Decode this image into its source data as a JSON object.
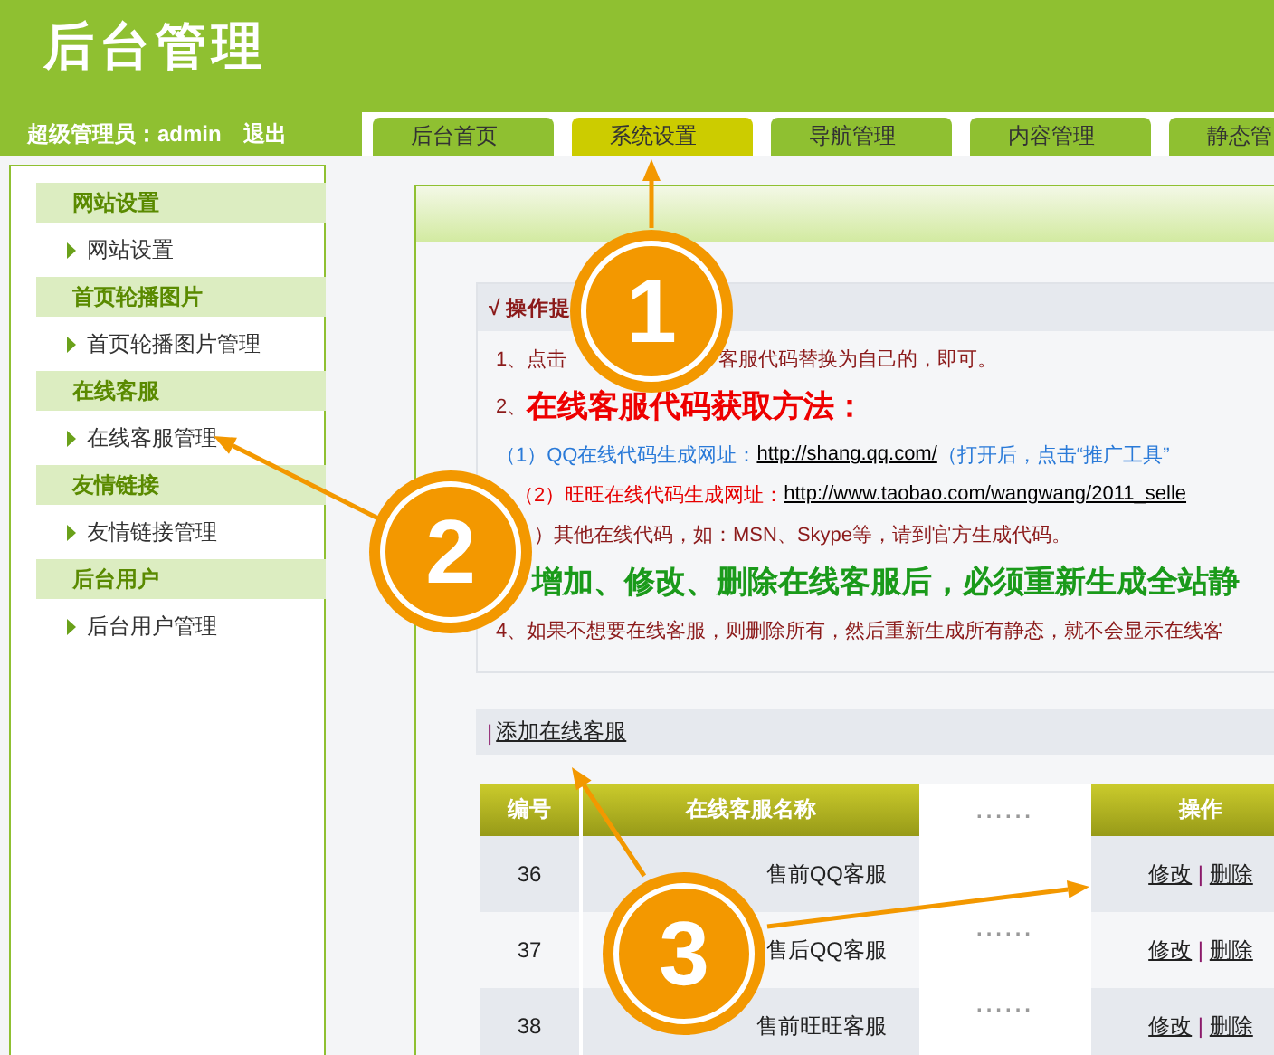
{
  "header": {
    "title": "后台管理",
    "user_label": "超级管理员：admin",
    "logout": "退出"
  },
  "tabs": [
    {
      "label": "后台首页",
      "selected": false
    },
    {
      "label": "系统设置",
      "selected": true
    },
    {
      "label": "导航管理",
      "selected": false
    },
    {
      "label": "内容管理",
      "selected": false
    },
    {
      "label": "静态管",
      "selected": false
    }
  ],
  "sidebar": {
    "sections": [
      {
        "title": "网站设置",
        "items": [
          "网站设置"
        ]
      },
      {
        "title": "首页轮播图片",
        "items": [
          "首页轮播图片管理"
        ]
      },
      {
        "title": "在线客服",
        "items": [
          "在线客服管理"
        ]
      },
      {
        "title": "友情链接",
        "items": [
          "友情链接管理"
        ]
      },
      {
        "title": "后台用户",
        "items": [
          "后台用户管理"
        ]
      }
    ]
  },
  "notice": {
    "title": "√ 操作提",
    "lines": [
      {
        "kind": "gap",
        "before": "1、点击",
        "after": "客服代码替换为自己的，即可。"
      },
      {
        "kind": "heading",
        "number": "2、",
        "text": "在线客服代码获取方法："
      },
      {
        "kind": "link",
        "color": "#2a7ad8",
        "text": "（1）QQ在线代码生成网址：",
        "link": "http://shang.qq.com/",
        "after": "（打开后，点击“推广工具”"
      },
      {
        "kind": "link",
        "color": "#e60000",
        "text": "（2）旺旺在线代码生成网址：",
        "link": "http://www.taobao.com/wangwang/2011_selle"
      },
      {
        "kind": "indent",
        "text": "）其他在线代码，如：MSN、Skype等，请到官方生成代码。"
      },
      {
        "kind": "warning",
        "text": "增加、修改、删除在线客服后，必须重新生成全站静"
      },
      {
        "kind": "plain",
        "text": "4、如果不想要在线客服，则删除所有，然后重新生成所有静态，就不会显示在线客"
      }
    ]
  },
  "add_bar": {
    "mark": "|",
    "link": "添加在线客服"
  },
  "table": {
    "columns": [
      "编号",
      "在线客服名称",
      "......",
      "操作"
    ],
    "rows": [
      {
        "id": "36",
        "name": "售前QQ客服",
        "edit": "修改",
        "separator": "|",
        "delete": "删除"
      },
      {
        "id": "37",
        "name": "售后QQ客服",
        "dots": "......",
        "edit": "修改",
        "separator": "|",
        "delete": "删除"
      },
      {
        "id": "38",
        "name": "售前旺旺客服",
        "dots": "......",
        "edit": "修改",
        "separator": "|",
        "delete": "删除"
      }
    ]
  },
  "callouts": [
    {
      "number": "1"
    },
    {
      "number": "2"
    },
    {
      "number": "3"
    }
  ]
}
